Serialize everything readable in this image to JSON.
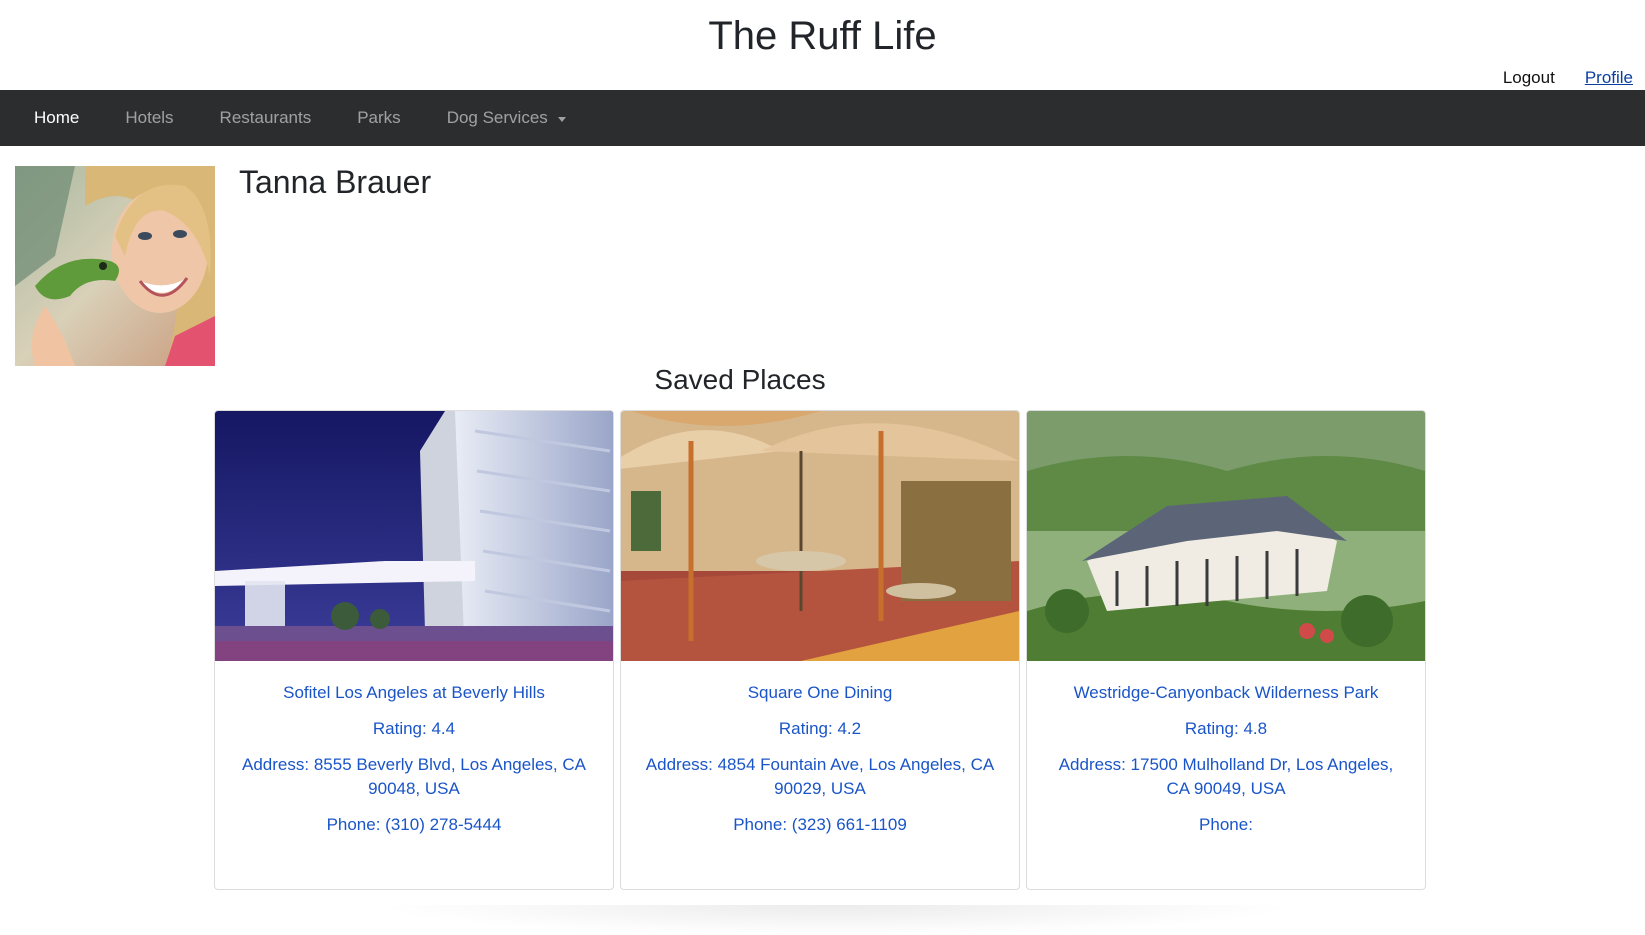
{
  "site": {
    "title": "The Ruff Life"
  },
  "auth": {
    "logout": "Logout",
    "profile": "Profile"
  },
  "nav": {
    "items": [
      {
        "label": "Home"
      },
      {
        "label": "Hotels"
      },
      {
        "label": "Restaurants"
      },
      {
        "label": "Parks"
      },
      {
        "label": "Dog Services"
      }
    ]
  },
  "user": {
    "name": "Tanna Brauer"
  },
  "saved": {
    "title": "Saved Places",
    "places": [
      {
        "name": "Sofitel Los Angeles at Beverly Hills",
        "rating": "Rating: 4.4",
        "address": "Address: 8555 Beverly Blvd, Los Angeles, CA 90048, USA",
        "phone": "Phone: (310) 278-5444"
      },
      {
        "name": "Square One Dining",
        "rating": "Rating: 4.2",
        "address": "Address: 4854 Fountain Ave, Los Angeles, CA 90029, USA",
        "phone": "Phone: (323) 661-1109"
      },
      {
        "name": "Westridge-Canyonback Wilderness Park",
        "rating": "Rating: 4.8",
        "address": "Address: 17500 Mulholland Dr, Los Angeles, CA 90049, USA",
        "phone": "Phone: "
      }
    ]
  },
  "colors": {
    "navbar": "#2b2d2f",
    "link": "#1a55c8"
  }
}
